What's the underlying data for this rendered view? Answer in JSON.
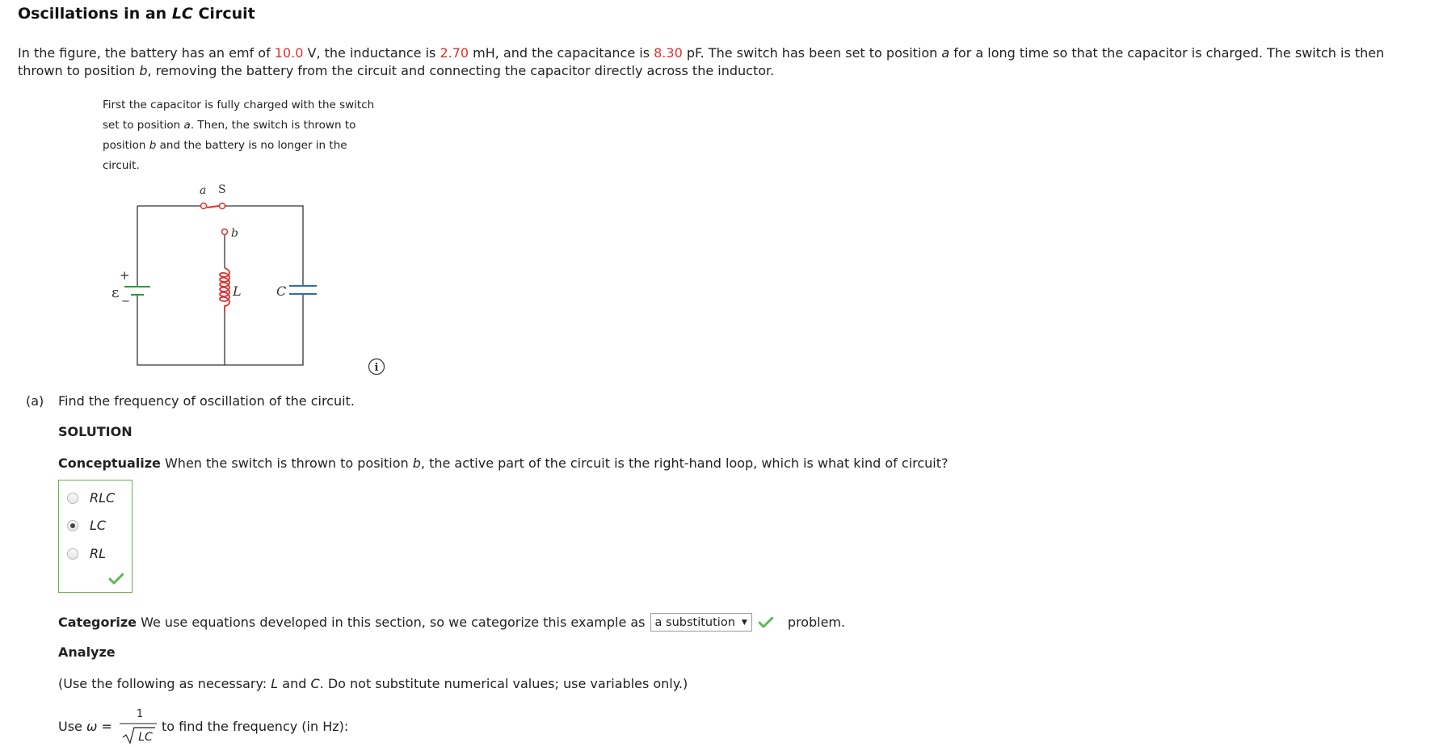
{
  "header": {
    "title_prefix": "Oscillations in an ",
    "title_italic": "LC",
    "title_suffix": " Circuit"
  },
  "intro": {
    "t1": "In the figure, the battery has an emf of ",
    "emf": "10.0",
    "t2": " V, the inductance is ",
    "inductance": "2.70",
    "t3": " mH, and the capacitance is ",
    "capacitance": "8.30",
    "t4": " pF. The switch has been set to position ",
    "pos_a": "a",
    "t5": " for a long time so that the capacitor is charged. The switch is then thrown to position ",
    "pos_b": "b",
    "t6": ", removing the battery from the circuit and connecting the capacitor directly across the inductor."
  },
  "figure": {
    "caption_1": "First the capacitor is fully charged with the switch set to position ",
    "caption_a": "a",
    "caption_2": ". Then, the switch is thrown to position ",
    "caption_b": "b",
    "caption_3": " and the battery is no longer in the circuit.",
    "label_a": "a",
    "label_s": "S",
    "label_b": "b",
    "label_plus": "+",
    "label_minus": "−",
    "label_emf": "ε",
    "label_L": "L",
    "label_C": "C",
    "info_glyph": "i",
    "colors": {
      "switch": "#e03030",
      "inductor": "#e03030",
      "battery": "#2a9d3a",
      "capacitor": "#2a6db5",
      "wire": "#333333"
    }
  },
  "part_a": {
    "label": "(a)",
    "question": "Find the frequency of oscillation of the circuit."
  },
  "solution_label": "SOLUTION",
  "conceptualize": {
    "label": "Conceptualize",
    "text_1": " When the switch is thrown to position ",
    "text_b": "b",
    "text_2": ", the active part of the circuit is the right-hand loop, which is what kind of circuit?",
    "options": [
      "RLC",
      "LC",
      "RL"
    ],
    "selected": "LC"
  },
  "categorize": {
    "label": "Categorize",
    "text_1": " We use equations developed in this section, so we categorize this example as",
    "select_value": "a substitution",
    "text_2": "problem."
  },
  "analyze_label": "Analyze",
  "use_following": {
    "t1": "(Use the following as necessary: ",
    "L": "L",
    "t2": " and ",
    "C": "C",
    "t3": ". Do not substitute numerical values; use variables only.)"
  },
  "use_omega": {
    "prefix": "Use ",
    "omega": "ω",
    "equals": " =",
    "numerator": "1",
    "denominator": "LC",
    "suffix": "to find the frequency (in Hz):"
  }
}
